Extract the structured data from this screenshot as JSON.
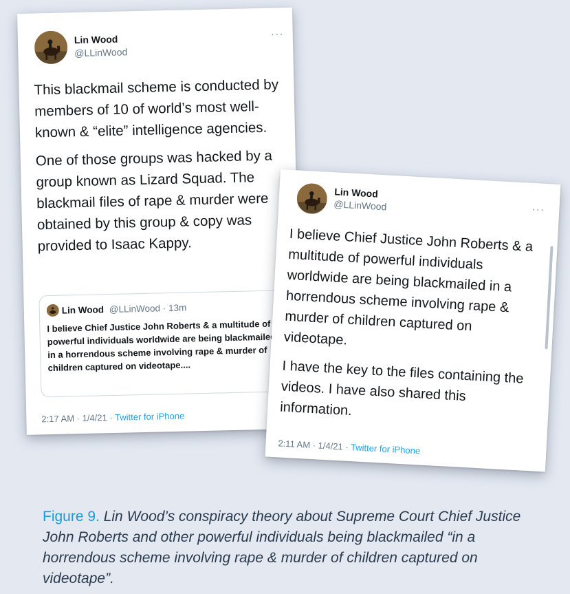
{
  "tweet_left": {
    "name": "Lin Wood",
    "handle": "@LLinWood",
    "more": "···",
    "paragraphs": [
      "This blackmail scheme is conducted by members of 10 of world’s most well-known & “elite” intelligence agencies.",
      "One of those groups was hacked by a group known as Lizard Squad. The blackmail files of rape & murder were obtained by this group & copy was provided to Isaac Kappy."
    ],
    "quote": {
      "name": "Lin Wood",
      "meta": "@LLinWood · 13m",
      "text": "I believe Chief Justice John Roberts & a multitude of powerful individuals worldwide are being blackmailed in a horrendous scheme involving rape & murder of children captured on videotape...."
    },
    "footer_time": "2:17 AM · 1/4/21 · ",
    "footer_source": "Twitter for iPhone"
  },
  "tweet_right": {
    "name": "Lin Wood",
    "handle": "@LLinWood",
    "more": "···",
    "paragraphs": [
      "I believe Chief Justice John Roberts & a multitude of powerful individuals worldwide are being blackmailed in a horrendous scheme involving rape & murder of children captured on videotape.",
      "I have the key to the files containing the videos. I have also shared this information."
    ],
    "footer_time": "2:11 AM · 1/4/21 · ",
    "footer_source": "Twitter for iPhone"
  },
  "caption": {
    "label": "Figure 9.",
    "text": " Lin Wood’s conspiracy theory about Supreme Court Chief Justice John Roberts and other powerful individuals being blackmailed “in a horrendous scheme involving rape & murder of children captured on videotape”."
  },
  "colors": {
    "background": "#e3e8f1",
    "twitter_blue": "#1da1f2",
    "caption_label": "#1b9ad6"
  },
  "icons": [
    "avatar-horse-rider",
    "more-dots-icon"
  ]
}
